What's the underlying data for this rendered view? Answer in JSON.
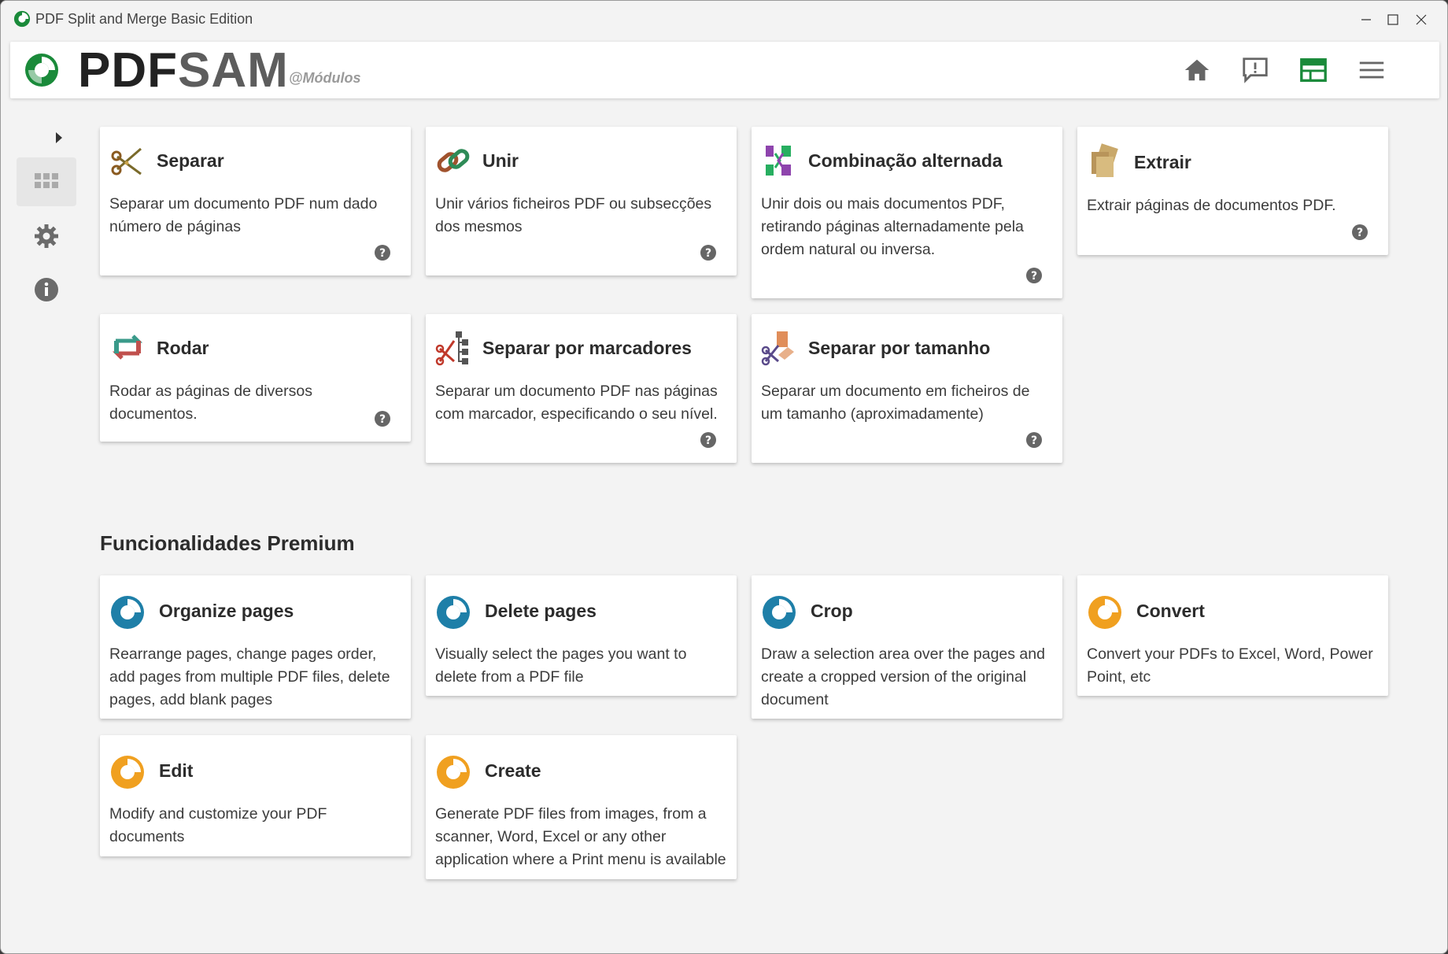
{
  "window": {
    "title": "PDF Split and Merge Basic Edition",
    "controls": [
      "minimize",
      "maximize",
      "close"
    ]
  },
  "header": {
    "logo_pdf": "PDF",
    "logo_sam": "SAM",
    "logo_sub": "@Módulos",
    "buttons": [
      "home-icon",
      "feedback-icon",
      "dashboard-icon",
      "menu-icon"
    ],
    "accent_color": "#1a8a3a"
  },
  "sidebar": {
    "items": [
      "modules-grid-icon",
      "settings-gear-icon",
      "info-icon"
    ]
  },
  "modules": [
    {
      "title": "Separar",
      "description": "Separar um documento PDF num dado número de páginas",
      "icon": "scissors-icon"
    },
    {
      "title": "Unir",
      "description": "Unir vários ficheiros PDF ou subsecções dos mesmos",
      "icon": "chain-links-icon"
    },
    {
      "title": "Combinação alternada",
      "description": "Unir dois ou mais documentos PDF, retirando páginas alternadamente pela ordem natural ou inversa.",
      "icon": "alternate-mix-icon"
    },
    {
      "title": "Extrair",
      "description": "Extrair páginas de documentos PDF.",
      "icon": "extract-pages-icon"
    },
    {
      "title": "Rodar",
      "description": "Rodar as páginas de diversos documentos.",
      "icon": "rotate-icon"
    },
    {
      "title": "Separar por marcadores",
      "description": "Separar um documento PDF nas páginas com marcador, especificando o seu nível.",
      "icon": "bookmark-tree-scissors-icon"
    },
    {
      "title": "Separar por tamanho",
      "description": "Separar um documento em ficheiros de um tamanho (aproximadamente)",
      "icon": "size-scissors-icon"
    }
  ],
  "premium": {
    "section_title": "Funcionalidades Premium",
    "items": [
      {
        "title": "Organize pages",
        "description": "Rearrange pages, change pages order, add pages from multiple PDF files, delete pages, add blank pages",
        "color": "#1e7fa8"
      },
      {
        "title": "Delete pages",
        "description": "Visually select the pages you want to delete from a PDF file",
        "color": "#1e7fa8"
      },
      {
        "title": "Crop",
        "description": "Draw a selection area over the pages and create a cropped version of the original document",
        "color": "#1e7fa8"
      },
      {
        "title": "Convert",
        "description": "Convert your PDFs to Excel, Word, Power Point, etc",
        "color": "#f0a020"
      },
      {
        "title": "Edit",
        "description": "Modify and customize your PDF documents",
        "color": "#f0a020"
      },
      {
        "title": "Create",
        "description": "Generate PDF files from images, from a scanner, Word, Excel or any other application where a Print menu is available",
        "color": "#f0a020"
      }
    ]
  }
}
